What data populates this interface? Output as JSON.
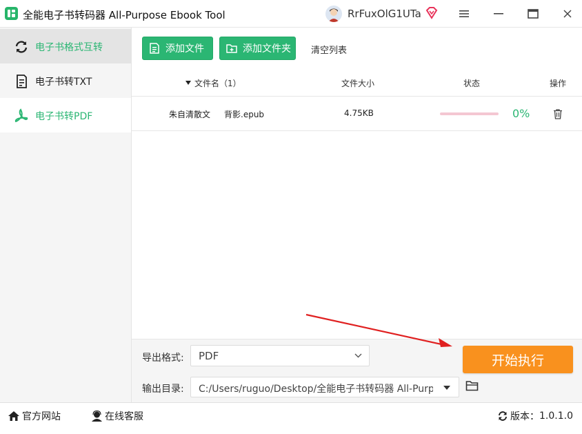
{
  "titlebar": {
    "title": "全能电子书转码器 All-Purpose Ebook Tool",
    "username": "RrFuxOlG1UTa",
    "app_logo_icon": "app-logo-icon",
    "vip_icon": "vip-diamond-icon"
  },
  "window_controls": {
    "menu_icon": "hamburger-menu-icon",
    "minimize_icon": "minimize-icon",
    "maximize_icon": "maximize-icon",
    "close_icon": "close-icon"
  },
  "sidebar": {
    "items": [
      {
        "label": "电子书格式互转",
        "icon": "refresh-icon",
        "state": "selected"
      },
      {
        "label": "电子书转TXT",
        "icon": "document-icon",
        "state": "normal"
      },
      {
        "label": "电子书转PDF",
        "icon": "pdf-icon",
        "state": "highlighted"
      }
    ]
  },
  "toolbar": {
    "add_file": "添加文件",
    "add_folder": "添加文件夹",
    "clear_list": "清空列表"
  },
  "table": {
    "headers": {
      "filename": "文件名（1）",
      "size": "文件大小",
      "status": "状态",
      "action": "操作"
    },
    "rows": [
      {
        "folder": "朱自清散文",
        "filename": "背影.epub",
        "size": "4.75KB",
        "progress": 0,
        "progress_text": "0%"
      }
    ]
  },
  "export": {
    "format_label": "导出格式:",
    "format_value": "PDF",
    "output_label": "输出目录:",
    "output_value": "C:/Users/ruguo/Desktop/全能电子书转码器 All-Purp",
    "start_button": "开始执行"
  },
  "statusbar": {
    "website": "官方网站",
    "support": "在线客服",
    "version_label": "版本：",
    "version_value": "1.0.1.0"
  },
  "colors": {
    "accent_green": "#2bb673",
    "start_orange": "#f9911e",
    "annotation_red": "#e02020",
    "progress_pink": "#f4c7d2"
  }
}
